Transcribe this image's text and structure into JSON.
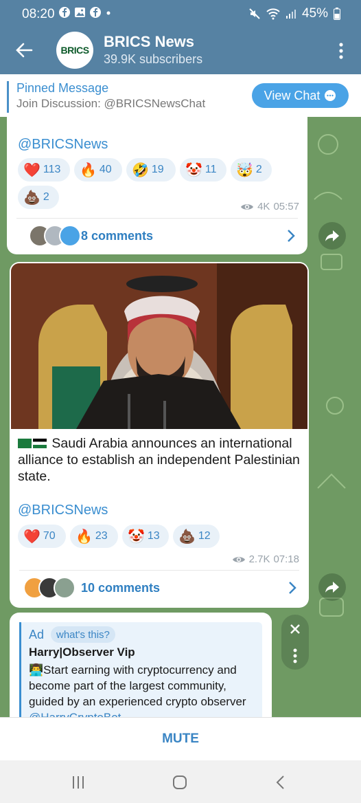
{
  "status_bar": {
    "time": "08:20",
    "battery": "45%"
  },
  "header": {
    "title": "BRICS News",
    "subtitle": "39.9K subscribers",
    "avatar_text": "BRICS"
  },
  "pinned": {
    "title": "Pinned Message",
    "text": "Join Discussion: @BRICSNewsChat",
    "button": "View Chat"
  },
  "post1": {
    "handle": "@BRICSNews",
    "reactions": [
      {
        "emoji": "❤️",
        "count": "113"
      },
      {
        "emoji": "🔥",
        "count": "40"
      },
      {
        "emoji": "🤣",
        "count": "19"
      },
      {
        "emoji": "🤡",
        "count": "11"
      },
      {
        "emoji": "🤯",
        "count": "2"
      },
      {
        "emoji": "💩",
        "count": "2"
      }
    ],
    "views": "4K",
    "time": "05:57",
    "comments": "8 comments"
  },
  "post2": {
    "text": "Saudi Arabia announces an international alliance to establish an independent Palestinian state.",
    "handle": "@BRICSNews",
    "reactions": [
      {
        "emoji": "❤️",
        "count": "70"
      },
      {
        "emoji": "🔥",
        "count": "23"
      },
      {
        "emoji": "🤡",
        "count": "13"
      },
      {
        "emoji": "💩",
        "count": "12"
      }
    ],
    "views": "2.7K",
    "time": "07:18",
    "comments": "10 comments"
  },
  "ad": {
    "label": "Ad",
    "whats_this": "what's this?",
    "name": "Harry|Observer Vip",
    "text": "Start earning with cryptocurrency and become part of the largest community, guided by an experienced crypto observer",
    "link": "@HarryCryptoBot"
  },
  "bottom": {
    "mute": "MUTE"
  }
}
